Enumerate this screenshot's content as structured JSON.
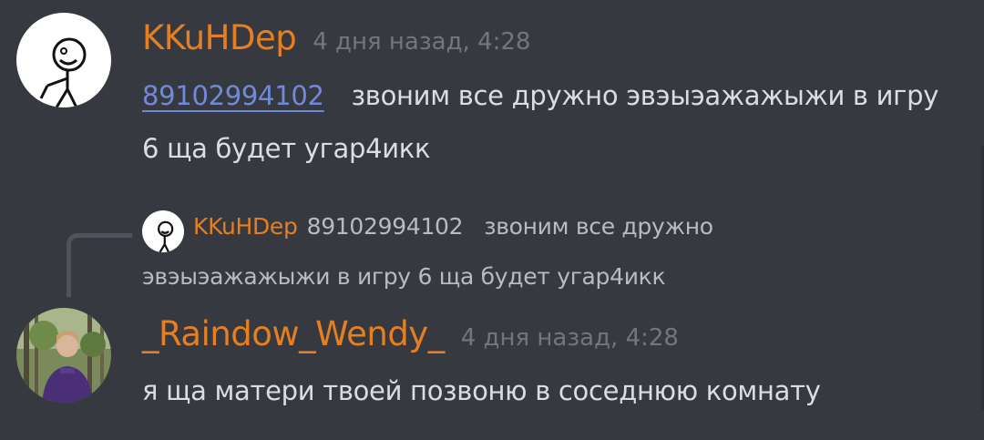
{
  "messages": [
    {
      "author": "KKuHDep",
      "timestamp": "4 дня назад, 4:28",
      "mention": "89102994102",
      "text_after_mention": "звоним все дружно эвэыэажажыжи в игру 6 ща будет угар4икк",
      "avatar_icon": "stick-figure-avatar"
    },
    {
      "author": "_Raindow_Wendy_",
      "timestamp": "4 дня назад, 4:28",
      "text": "я ща матери твоей позвоню в соседнюю комнату",
      "avatar_icon": "photo-avatar",
      "reply": {
        "author": "KKuHDep",
        "line1": "89102994102   звоним все дружно",
        "line2": "эвэыэажажыжи в игру 6 ща будет угар4икк"
      }
    }
  ],
  "colors": {
    "background": "#36393f",
    "username": "#e67e22",
    "timestamp": "#72767d",
    "text": "#dcddde",
    "mention": "#7289da",
    "reply_text": "#b9bbbe"
  }
}
